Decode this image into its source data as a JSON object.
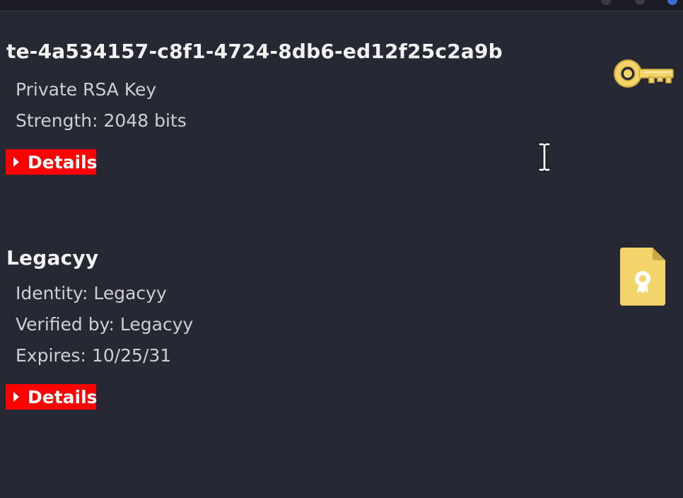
{
  "window": {
    "controls": [
      "minimize",
      "maximize",
      "close"
    ]
  },
  "entries": [
    {
      "title": "te-4a534157-c8f1-4724-8db6-ed12f25c2a9b",
      "lines": [
        "Private RSA Key",
        "Strength: 2048 bits"
      ],
      "details_label": "Details",
      "icon": "key-icon"
    },
    {
      "title": "Legacyy",
      "lines": [
        "Identity: Legacyy",
        "Verified by: Legacyy",
        "Expires: 10/25/31"
      ],
      "details_label": "Details",
      "icon": "certificate-icon"
    }
  ],
  "colors": {
    "background": "#262833",
    "details_button": "#ff0000",
    "icon_gold": "#f2d46a"
  }
}
